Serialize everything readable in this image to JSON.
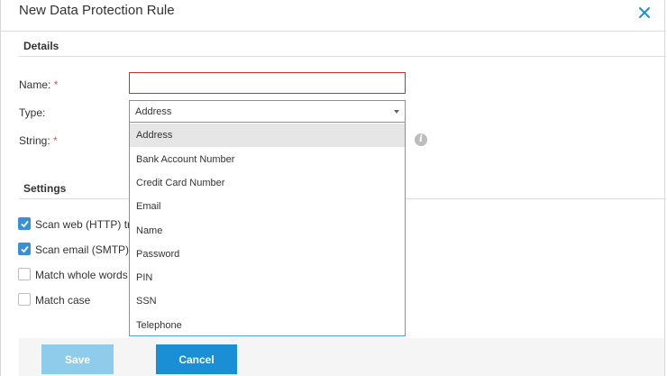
{
  "dialog": {
    "title": "New Data Protection Rule"
  },
  "details": {
    "section_title": "Details",
    "name_label": "Name:",
    "type_label": "Type:",
    "string_label": "String:",
    "required_mark": "*",
    "name_value": "",
    "type_selected": "Address",
    "type_options": [
      "Address",
      "Bank Account Number",
      "Credit Card Number",
      "Email",
      "Name",
      "Password",
      "PIN",
      "SSN",
      "Telephone"
    ],
    "info_glyph": "i"
  },
  "settings": {
    "section_title": "Settings",
    "checkboxes": [
      {
        "label": "Scan web (HTTP) tra",
        "checked": true
      },
      {
        "label": "Scan email (SMTP) t",
        "checked": true
      },
      {
        "label": "Match whole words",
        "checked": false
      },
      {
        "label": "Match case",
        "checked": false
      }
    ]
  },
  "footer": {
    "save_label": "Save",
    "cancel_label": "Cancel"
  },
  "colors": {
    "accent": "#1b8fd6",
    "accent_disabled": "#8fcbeb",
    "error_border": "#c9302c",
    "focus_border": "#4aa3df"
  }
}
